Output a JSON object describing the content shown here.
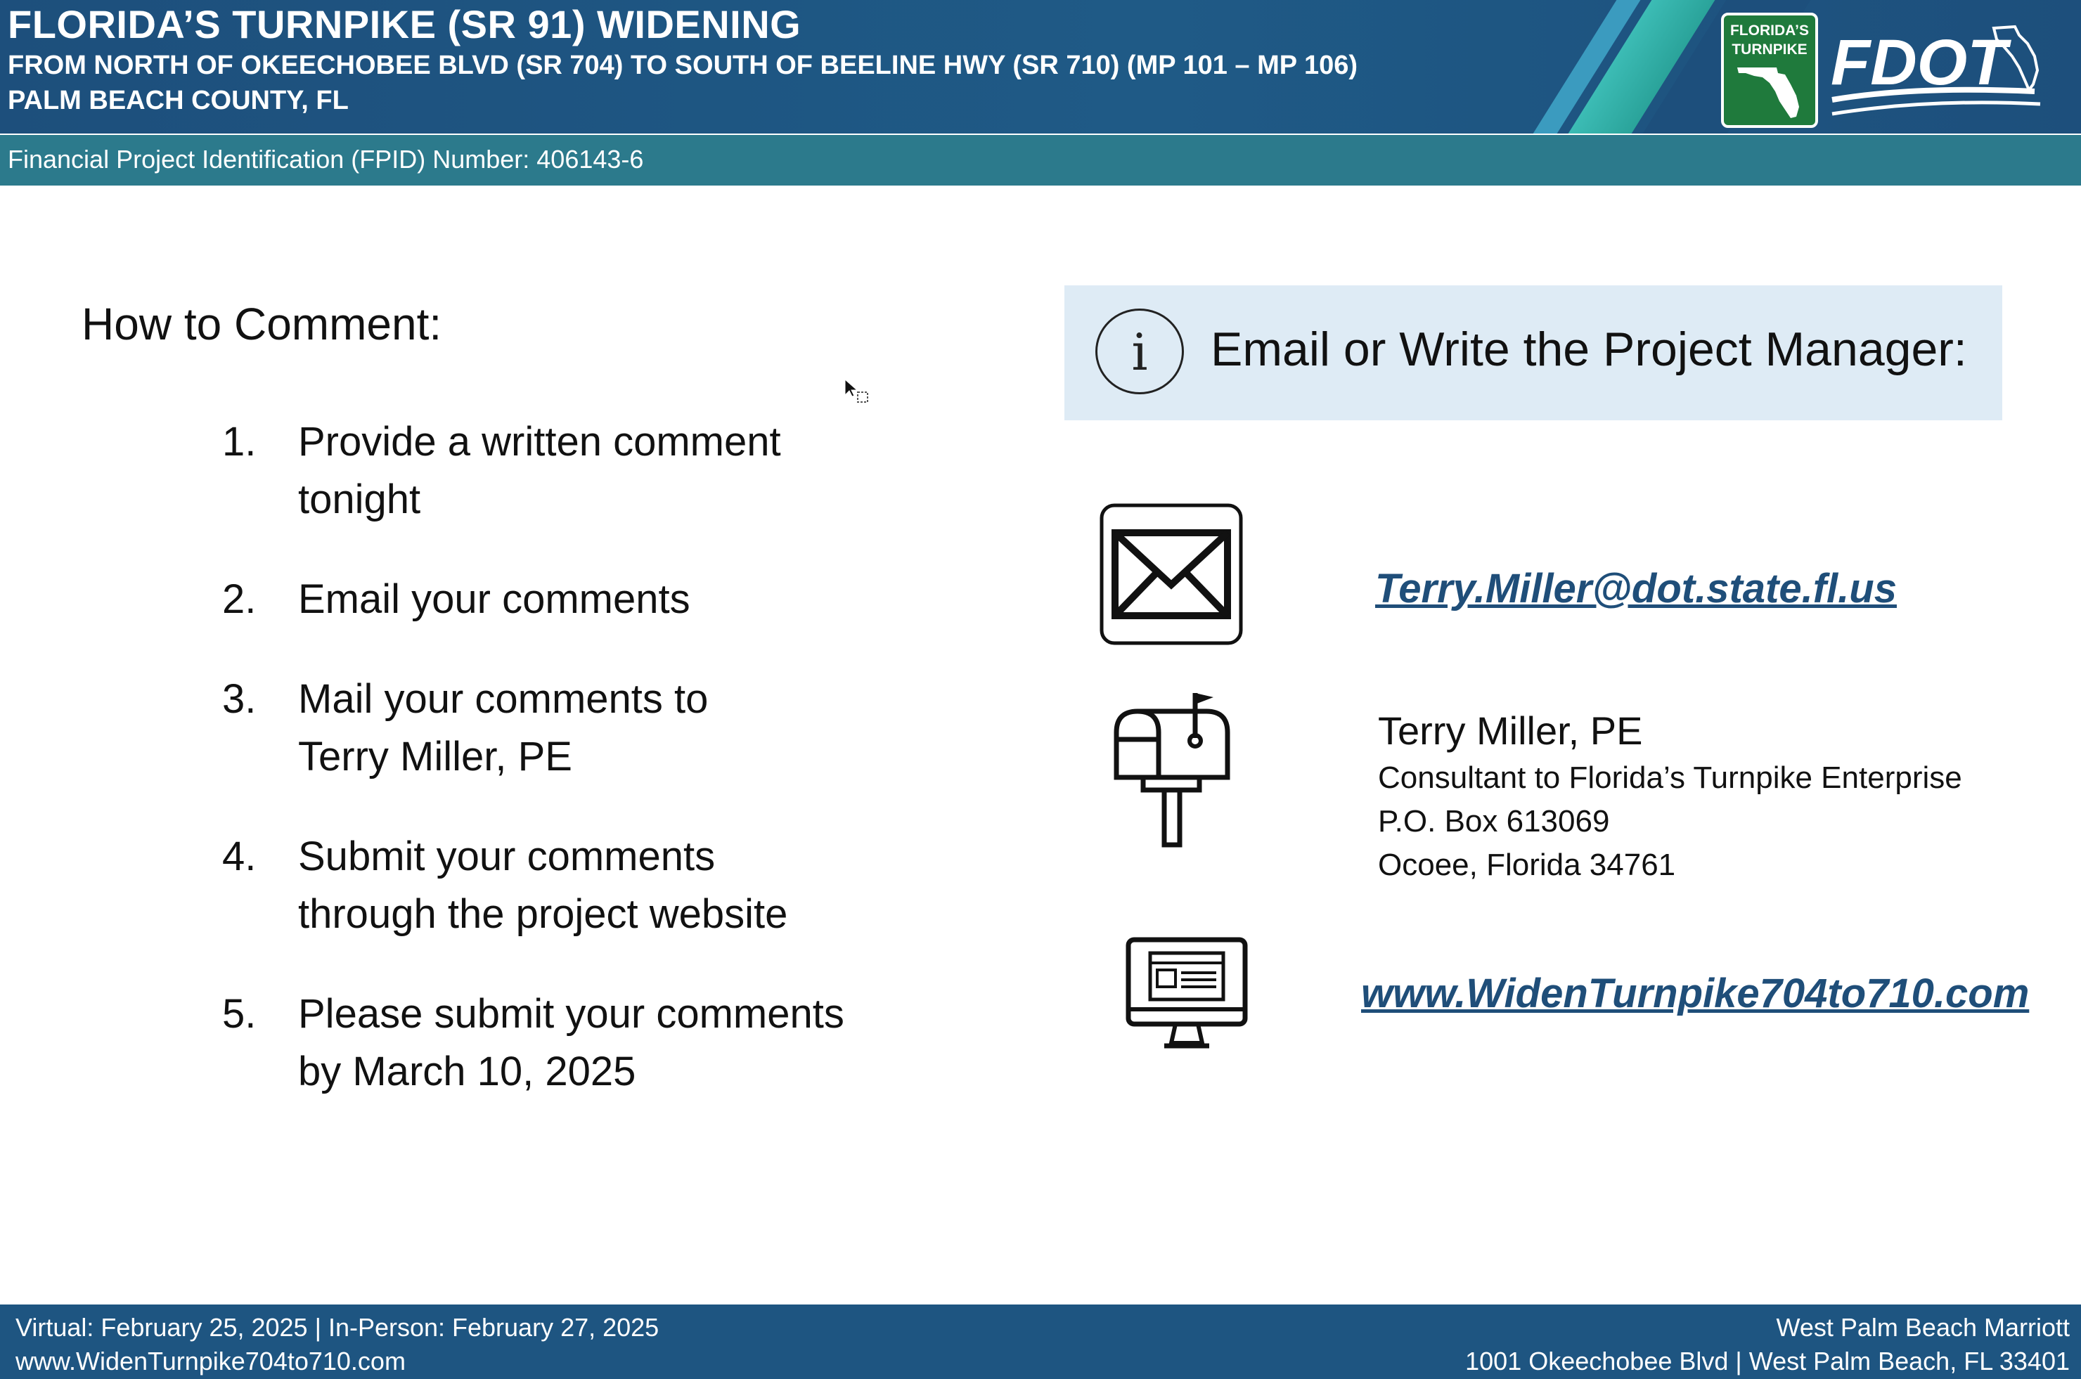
{
  "header": {
    "title": "FLORIDA’S TURNPIKE (SR 91) WIDENING",
    "subtitle_line1": "FROM NORTH OF OKEECHOBEE BLVD (SR 704) TO SOUTH OF BEELINE HWY (SR 710) (MP 101 – MP 106)",
    "subtitle_line2": "PALM BEACH COUNTY, FL",
    "turnpike_logo_line1": "FLORIDA’S",
    "turnpike_logo_line2": "TURNPIKE",
    "fdot_logo": "FDOT"
  },
  "fpid": {
    "text": "Financial Project Identification (FPID) Number: 406143-6"
  },
  "how_to_comment": {
    "title": "How to Comment:",
    "steps": [
      {
        "num": "1.",
        "line1": "Provide a written comment",
        "line2": "tonight"
      },
      {
        "num": "2.",
        "line1": "Email your comments",
        "line2": ""
      },
      {
        "num": "3.",
        "line1": "Mail your comments to",
        "line2": "Terry Miller, PE"
      },
      {
        "num": "4.",
        "line1": "Submit your comments",
        "line2": "through the project website"
      },
      {
        "num": "5.",
        "line1": "Please submit your comments",
        "line2": "by March 10, 2025"
      }
    ]
  },
  "contact": {
    "heading": "Email or Write the Project Manager:",
    "info_icon": "i",
    "email": "Terry.Miller@dot.state.fl.us",
    "mail_name": "Terry Miller, PE",
    "mail_org": "Consultant to Florida’s Turnpike Enterprise",
    "mail_box": "P.O. Box 613069",
    "mail_city": "Ocoee, Florida 34761",
    "website": "www.WidenTurnpike704to710.com",
    "icons": [
      "envelope-icon",
      "mailbox-icon",
      "monitor-icon",
      "info-icon"
    ]
  },
  "footer": {
    "left_line1": "Virtual: February 25, 2025 | In-Person: February 27, 2025",
    "left_line2": "www.WidenTurnpike704to710.com",
    "right_line1": "West Palm Beach Marriott",
    "right_line2": "1001 Okeechobee Blvd | West Palm Beach, FL 33401"
  },
  "colors": {
    "header_blue": "#1d4f7c",
    "fpid_teal": "#2c7a8c",
    "info_box": "#deebf5",
    "link": "#1f4e79",
    "turnpike_green": "#1f7a3c",
    "footer_blue": "#1e5581"
  }
}
